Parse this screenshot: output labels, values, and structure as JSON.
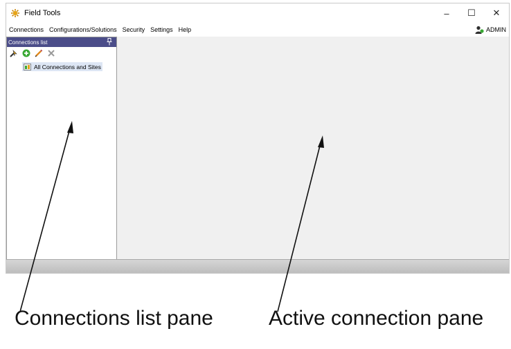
{
  "window": {
    "title": "Field Tools",
    "controls": {
      "minimize": "–",
      "maximize": "☐",
      "close": "✕"
    }
  },
  "menu": {
    "items": [
      "Connections",
      "Configurations/Solutions",
      "Security",
      "Settings",
      "Help"
    ],
    "user": "ADMIN"
  },
  "connections_pane": {
    "header": "Connections list",
    "toolbar": [
      "connect-icon",
      "add-icon",
      "edit-icon",
      "delete-icon"
    ],
    "tree": [
      {
        "label": "All Connections and Sites"
      }
    ]
  },
  "annotations": {
    "left_caption": "Connections list pane",
    "right_caption": "Active connection pane"
  },
  "colors": {
    "pane_header": "#4b4d89",
    "selection": "#dde6f4",
    "add_green": "#3aa935",
    "edit_orange": "#e08a1e",
    "delete_gray": "#9a9a9a"
  }
}
